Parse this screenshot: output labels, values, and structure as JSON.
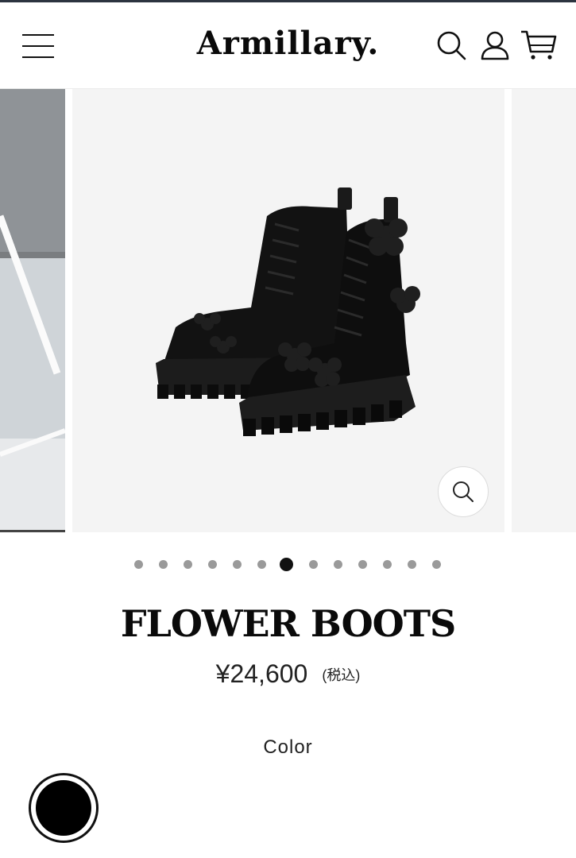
{
  "header": {
    "logo": "Armillary.",
    "menu_icon": "hamburger-menu-icon",
    "search_icon": "search-icon",
    "account_icon": "user-icon",
    "cart_icon": "cart-icon"
  },
  "gallery": {
    "total_slides": 13,
    "active_index": 6,
    "zoom_icon": "zoom-icon",
    "image_subject": "black-lace-up-platform-boots-with-flowers"
  },
  "product": {
    "title": "FLOWER BOOTS",
    "price": "¥24,600",
    "tax_note": "(税込)",
    "color_label": "Color",
    "selected_color": "#000000"
  },
  "colors": {
    "topline": "#2c3440",
    "text": "#111111",
    "dot_inactive": "#9a9a9a",
    "dot_active": "#111111"
  }
}
